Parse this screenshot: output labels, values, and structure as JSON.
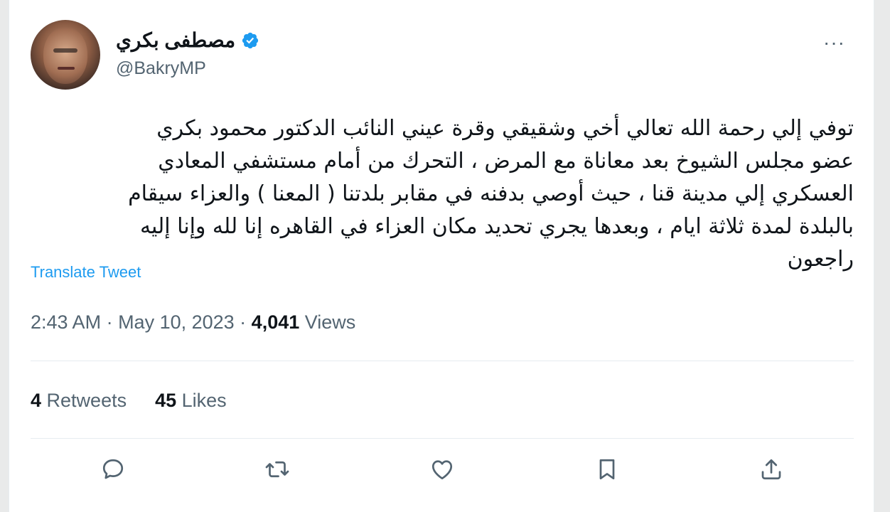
{
  "author": {
    "display_name": "مصطفى بكري",
    "handle": "@BakryMP"
  },
  "more_label": "···",
  "tweet": {
    "lines": [
      "توفي إلي رحمة الله تعالي أخي وشقيقي وقرة عيني النائب الدكتور محمود بكري",
      "عضو مجلس الشيوخ بعد معاناة مع المرض ، التحرك من أمام مستشفي المعادي",
      "العسكري إلي مدينة قنا ، حيث أوصي بدفنه في مقابر بلدتنا ( المعنا ) والعزاء سيقام",
      "بالبلدة لمدة ثلاثة ايام ، وبعدها يجري تحديد مكان العزاء في القاهره إنا لله وإنا إليه",
      "راجعون"
    ],
    "translate_label": "Translate Tweet"
  },
  "meta": {
    "time": "2:43 AM",
    "sep1": " · ",
    "date": "May 10, 2023",
    "sep2": " · ",
    "views_count": "4,041",
    "views_label": " Views"
  },
  "stats": {
    "retweets_count": "4",
    "retweets_label": " Retweets",
    "likes_count": "45",
    "likes_label": " Likes"
  },
  "actions": [
    {
      "icon": "reply-icon"
    },
    {
      "icon": "retweet-icon"
    },
    {
      "icon": "like-icon"
    },
    {
      "icon": "bookmark-icon"
    },
    {
      "icon": "share-icon"
    }
  ],
  "colors": {
    "accent": "#1d9bf0",
    "text": "#0f1419",
    "secondary": "#536471"
  }
}
